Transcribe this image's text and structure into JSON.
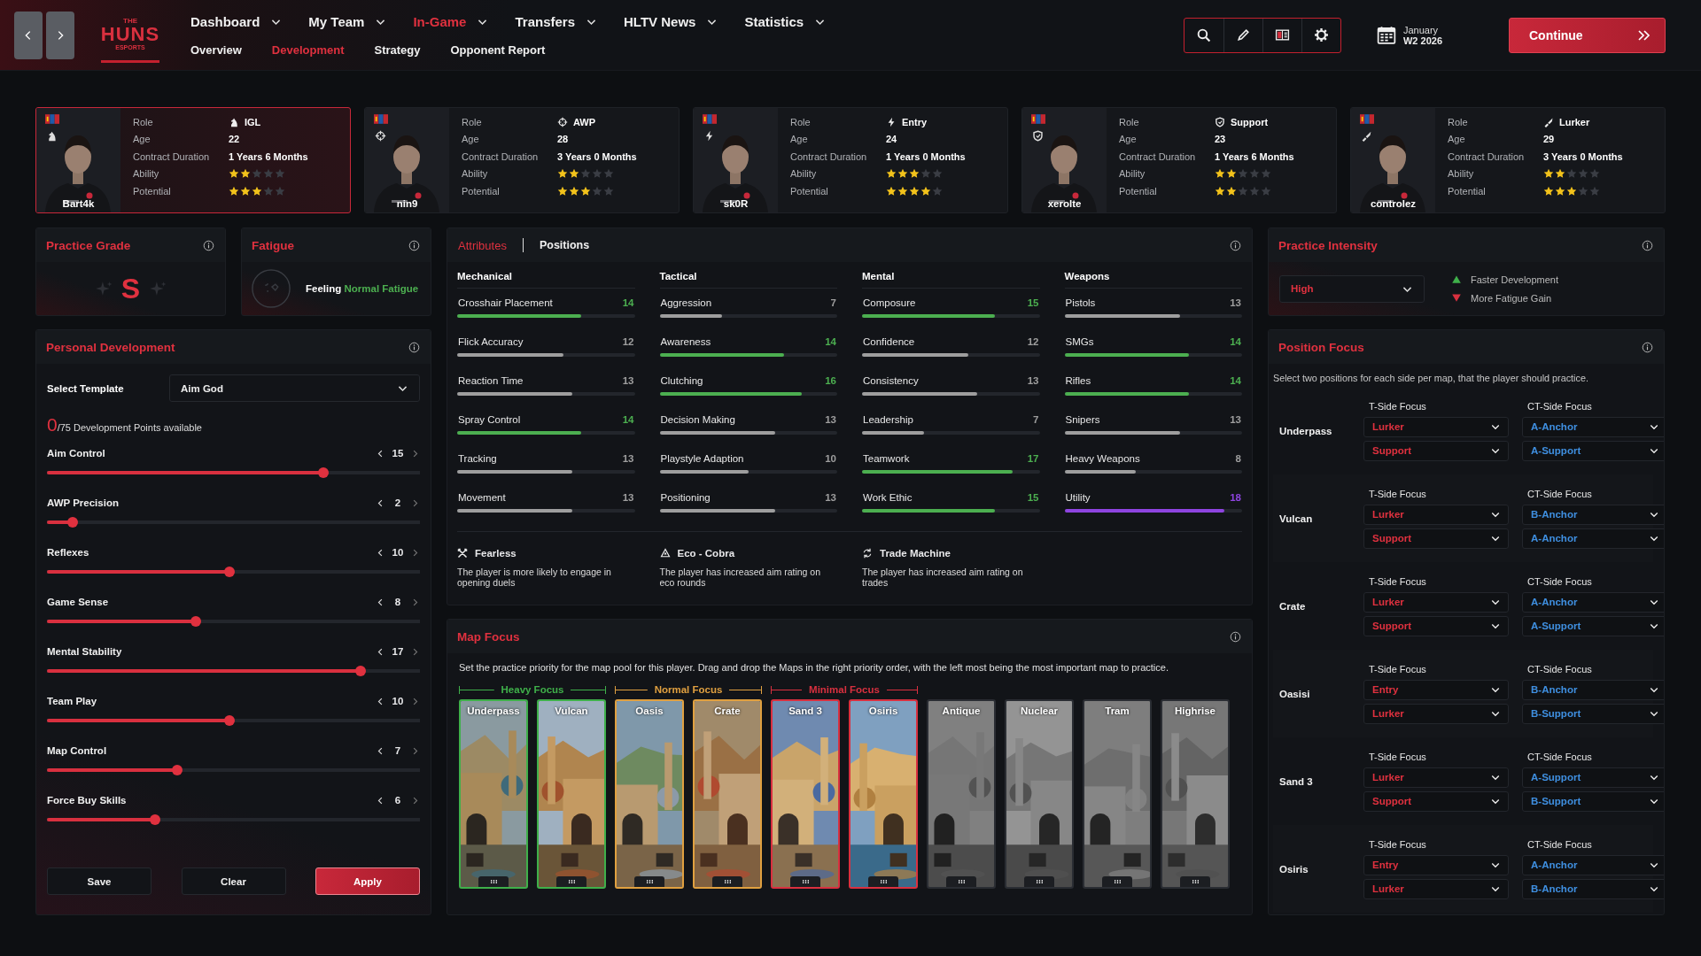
{
  "nav": {
    "menu": [
      {
        "label": "Dashboard",
        "selected": false
      },
      {
        "label": "My Team",
        "selected": false
      },
      {
        "label": "In-Game",
        "selected": true
      },
      {
        "label": "Transfers",
        "selected": false
      },
      {
        "label": "HLTV News",
        "selected": false
      },
      {
        "label": "Statistics",
        "selected": false
      }
    ],
    "tabs": [
      {
        "label": "Overview",
        "selected": false
      },
      {
        "label": "Development",
        "selected": true
      },
      {
        "label": "Strategy",
        "selected": false
      },
      {
        "label": "Opponent Report",
        "selected": false
      }
    ]
  },
  "logo": {
    "top": "THE",
    "main": "HUNS",
    "bottom": "ESPORTS"
  },
  "date": {
    "month": "January",
    "week": "W2 2026"
  },
  "continue_button": "Continue",
  "players": [
    {
      "name": "Bart4k",
      "role": "IGL",
      "kind": "igl",
      "age": "22",
      "contract": "1 Years 6 Months",
      "ability": {
        "stars": 2
      },
      "potential": {
        "stars": 3
      },
      "selected": true,
      "labels": [
        "Role",
        "Age",
        "Contract Duration",
        "Ability",
        "Potential"
      ]
    },
    {
      "name": "nin9",
      "role": "AWP",
      "kind": "awp",
      "age": "28",
      "contract": "3 Years 0 Months",
      "ability": {
        "stars": 2
      },
      "potential": {
        "stars": 3
      },
      "selected": false,
      "labels": [
        "Role",
        "Age",
        "Contract Duration",
        "Ability",
        "Potential"
      ]
    },
    {
      "name": "sk0R",
      "role": "Entry",
      "kind": "entry",
      "age": "24",
      "contract": "1 Years 0 Months",
      "ability": {
        "stars": 3
      },
      "potential": {
        "stars": 4
      },
      "selected": false,
      "labels": [
        "Role",
        "Age",
        "Contract Duration",
        "Ability",
        "Potential"
      ]
    },
    {
      "name": "xerolte",
      "role": "Support",
      "kind": "support",
      "age": "23",
      "contract": "1 Years 6 Months",
      "ability": {
        "stars": 2
      },
      "potential": {
        "stars": 2
      },
      "selected": false,
      "labels": [
        "Role",
        "Age",
        "Contract Duration",
        "Ability",
        "Potential"
      ]
    },
    {
      "name": "controlez",
      "role": "Lurker",
      "kind": "lurker",
      "age": "29",
      "contract": "3 Years 0 Months",
      "ability": {
        "stars": 2
      },
      "potential": {
        "stars": 3
      },
      "selected": false,
      "labels": [
        "Role",
        "Age",
        "Contract Duration",
        "Ability",
        "Potential"
      ]
    }
  ],
  "practice_grade": {
    "title": "Practice Grade",
    "grade": "S"
  },
  "fatigue": {
    "title": "Fatigue",
    "label": "Feeling",
    "status": "Normal Fatigue",
    "kind": "normal"
  },
  "development": {
    "title": "Personal Development",
    "template_label": "Select Template",
    "template": "Aim God",
    "points_spent": "0",
    "points_text": "/75 Development Points available",
    "sliders": [
      {
        "name": "Aim Control",
        "value": "15",
        "level": 0.74
      },
      {
        "name": "AWP Precision",
        "value": "2",
        "level": 0.07
      },
      {
        "name": "Reflexes",
        "value": "10",
        "level": 0.49
      },
      {
        "name": "Game Sense",
        "value": "8",
        "level": 0.4
      },
      {
        "name": "Mental Stability",
        "value": "17",
        "level": 0.84
      },
      {
        "name": "Team Play",
        "value": "10",
        "level": 0.49
      },
      {
        "name": "Map Control",
        "value": "7",
        "level": 0.35
      },
      {
        "name": "Force Buy Skills",
        "value": "6",
        "level": 0.29
      }
    ],
    "buttons": [
      {
        "label": "Save",
        "kind": "secondary"
      },
      {
        "label": "Clear",
        "kind": "secondary"
      },
      {
        "label": "Apply",
        "kind": "primary"
      }
    ]
  },
  "attributes": {
    "tabs": [
      {
        "label": "Attributes",
        "selected": true
      },
      {
        "label": "Positions",
        "selected": false
      }
    ],
    "groups": [
      {
        "title": "Mechanical",
        "items": [
          {
            "name": "Crosshair Placement",
            "value": "14",
            "level": 0.7,
            "color": "#4caf50"
          },
          {
            "name": "Flick Accuracy",
            "value": "12",
            "level": 0.6,
            "color": "#9e9e9e"
          },
          {
            "name": "Reaction Time",
            "value": "13",
            "level": 0.65,
            "color": "#9e9e9e"
          },
          {
            "name": "Spray Control",
            "value": "14",
            "level": 0.7,
            "color": "#4caf50"
          },
          {
            "name": "Tracking",
            "value": "13",
            "level": 0.65,
            "color": "#9e9e9e"
          },
          {
            "name": "Movement",
            "value": "13",
            "level": 0.65,
            "color": "#9e9e9e"
          }
        ]
      },
      {
        "title": "Tactical",
        "items": [
          {
            "name": "Aggression",
            "value": "7",
            "level": 0.35,
            "color": "#9e9e9e"
          },
          {
            "name": "Awareness",
            "value": "14",
            "level": 0.7,
            "color": "#4caf50"
          },
          {
            "name": "Clutching",
            "value": "16",
            "level": 0.8,
            "color": "#4caf50"
          },
          {
            "name": "Decision Making",
            "value": "13",
            "level": 0.65,
            "color": "#9e9e9e"
          },
          {
            "name": "Playstyle Adaption",
            "value": "10",
            "level": 0.5,
            "color": "#9e9e9e"
          },
          {
            "name": "Positioning",
            "value": "13",
            "level": 0.65,
            "color": "#9e9e9e"
          }
        ]
      },
      {
        "title": "Mental",
        "items": [
          {
            "name": "Composure",
            "value": "15",
            "level": 0.75,
            "color": "#4caf50"
          },
          {
            "name": "Confidence",
            "value": "12",
            "level": 0.6,
            "color": "#9e9e9e"
          },
          {
            "name": "Consistency",
            "value": "13",
            "level": 0.65,
            "color": "#9e9e9e"
          },
          {
            "name": "Leadership",
            "value": "7",
            "level": 0.35,
            "color": "#9e9e9e"
          },
          {
            "name": "Teamwork",
            "value": "17",
            "level": 0.85,
            "color": "#4caf50"
          },
          {
            "name": "Work Ethic",
            "value": "15",
            "level": 0.75,
            "color": "#4caf50"
          }
        ]
      },
      {
        "title": "Weapons",
        "items": [
          {
            "name": "Pistols",
            "value": "13",
            "level": 0.65,
            "color": "#9e9e9e"
          },
          {
            "name": "SMGs",
            "value": "14",
            "level": 0.7,
            "color": "#4caf50"
          },
          {
            "name": "Rifles",
            "value": "14",
            "level": 0.7,
            "color": "#4caf50"
          },
          {
            "name": "Snipers",
            "value": "13",
            "level": 0.65,
            "color": "#9e9e9e"
          },
          {
            "name": "Heavy Weapons",
            "value": "8",
            "level": 0.4,
            "color": "#9e9e9e"
          },
          {
            "name": "Utility",
            "value": "18",
            "level": 0.9,
            "color": "#8e44e0"
          }
        ]
      }
    ],
    "traits": [
      {
        "kind": "fearless",
        "name": "Fearless",
        "text": "The player is more likely to engage in opening duels"
      },
      {
        "kind": "eco",
        "name": "Eco - Cobra",
        "text": "The player has increased aim rating on eco rounds"
      },
      {
        "kind": "trade",
        "name": "Trade Machine",
        "text": "The player has increased aim rating on trades"
      }
    ]
  },
  "map_focus": {
    "title": "Map Focus",
    "text": "Set the practice priority for the map pool for this player. Drag and drop the Maps in the right priority order, with the left most being the most important map to practice.",
    "groups": [
      {
        "label": "Heavy Focus",
        "kind": "heavy"
      },
      {
        "label": "Normal Focus",
        "kind": "normal"
      },
      {
        "label": "Minimal Focus",
        "kind": "minimal"
      }
    ],
    "maps": [
      {
        "name": "Underpass",
        "kind": "heavy"
      },
      {
        "name": "Vulcan",
        "kind": "heavy"
      },
      {
        "name": "Oasis",
        "kind": "normal"
      },
      {
        "name": "Crate",
        "kind": "normal"
      },
      {
        "name": "Sand 3",
        "kind": "minimal"
      },
      {
        "name": "Osiris",
        "kind": "minimal"
      },
      {
        "name": "Antique",
        "kind": "none"
      },
      {
        "name": "Nuclear",
        "kind": "none"
      },
      {
        "name": "Tram",
        "kind": "none"
      },
      {
        "name": "Highrise",
        "kind": "none"
      }
    ]
  },
  "practice_intensity": {
    "title": "Practice Intensity",
    "value": "High",
    "effects": [
      {
        "text": "Faster Development",
        "kind": "up"
      },
      {
        "text": "More Fatigue Gain",
        "kind": "down"
      }
    ]
  },
  "position_focus": {
    "title": "Position Focus",
    "text": "Select two positions for each side per map, that the player should practice.",
    "rows": [
      {
        "map": "Underpass",
        "t_label": "T-Side Focus",
        "ct_label": "CT-Side Focus",
        "t": [
          "Lurker",
          "Support"
        ],
        "ct": [
          "A-Anchor",
          "A-Support"
        ]
      },
      {
        "map": "Vulcan",
        "t_label": "T-Side Focus",
        "ct_label": "CT-Side Focus",
        "t": [
          "Lurker",
          "Support"
        ],
        "ct": [
          "B-Anchor",
          "A-Anchor"
        ]
      },
      {
        "map": "Crate",
        "t_label": "T-Side Focus",
        "ct_label": "CT-Side Focus",
        "t": [
          "Lurker",
          "Support"
        ],
        "ct": [
          "A-Anchor",
          "A-Support"
        ]
      },
      {
        "map": "Oasisi",
        "t_label": "T-Side Focus",
        "ct_label": "CT-Side Focus",
        "t": [
          "Entry",
          "Lurker"
        ],
        "ct": [
          "B-Anchor",
          "B-Support"
        ]
      },
      {
        "map": "Sand 3",
        "t_label": "T-Side Focus",
        "ct_label": "CT-Side Focus",
        "t": [
          "Lurker",
          "Support"
        ],
        "ct": [
          "A-Support",
          "B-Support"
        ]
      },
      {
        "map": "Osiris",
        "t_label": "T-Side Focus",
        "ct_label": "CT-Side Focus",
        "t": [
          "Entry",
          "Lurker"
        ],
        "ct": [
          "A-Anchor",
          "B-Anchor"
        ]
      }
    ]
  }
}
